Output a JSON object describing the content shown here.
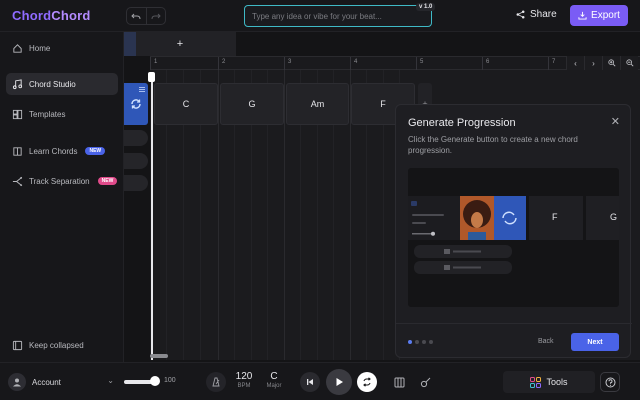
{
  "app": {
    "logo_part1": "Chord",
    "logo_part2": "Chord",
    "version": "v 1.0",
    "prompt_placeholder": "Type any idea or vibe for your beat...",
    "share_label": "Share",
    "export_label": "Export"
  },
  "sidebar": {
    "items": [
      {
        "label": "Home",
        "icon": "home-icon"
      },
      {
        "label": "Chord Studio",
        "icon": "music-note-icon",
        "active": true
      },
      {
        "label": "Templates",
        "icon": "templates-icon"
      },
      {
        "label": "Learn Chords",
        "icon": "book-icon",
        "badge": "NEW"
      },
      {
        "label": "Track Separation",
        "icon": "split-icon",
        "badge": "NEW"
      }
    ],
    "keep_collapsed": "Keep collapsed"
  },
  "timeline": {
    "add_track_label": "+",
    "bars": [
      "1",
      "2",
      "3",
      "4",
      "5",
      "6",
      "7"
    ],
    "chords": [
      "C",
      "G",
      "Am",
      "F"
    ],
    "add_chord_label": "+"
  },
  "modal": {
    "title": "Generate Progression",
    "description": "Click the Generate button to create a new chord progression.",
    "preview_chords": [
      "F",
      "G"
    ],
    "back_label": "Back",
    "next_label": "Next",
    "step_current": 1,
    "step_total": 4
  },
  "bottom": {
    "account_label": "Account",
    "volume": "100",
    "bpm_value": "120",
    "bpm_label": "BPM",
    "key_value": "C",
    "key_label": "Major",
    "tools_label": "Tools"
  },
  "colors": {
    "accent": "#7a5cf5",
    "blue": "#4a63e8",
    "prompt_border": "#3fb9c6",
    "badge_new": "#4a63e8",
    "badge_new_alt": "#e04a8a"
  }
}
